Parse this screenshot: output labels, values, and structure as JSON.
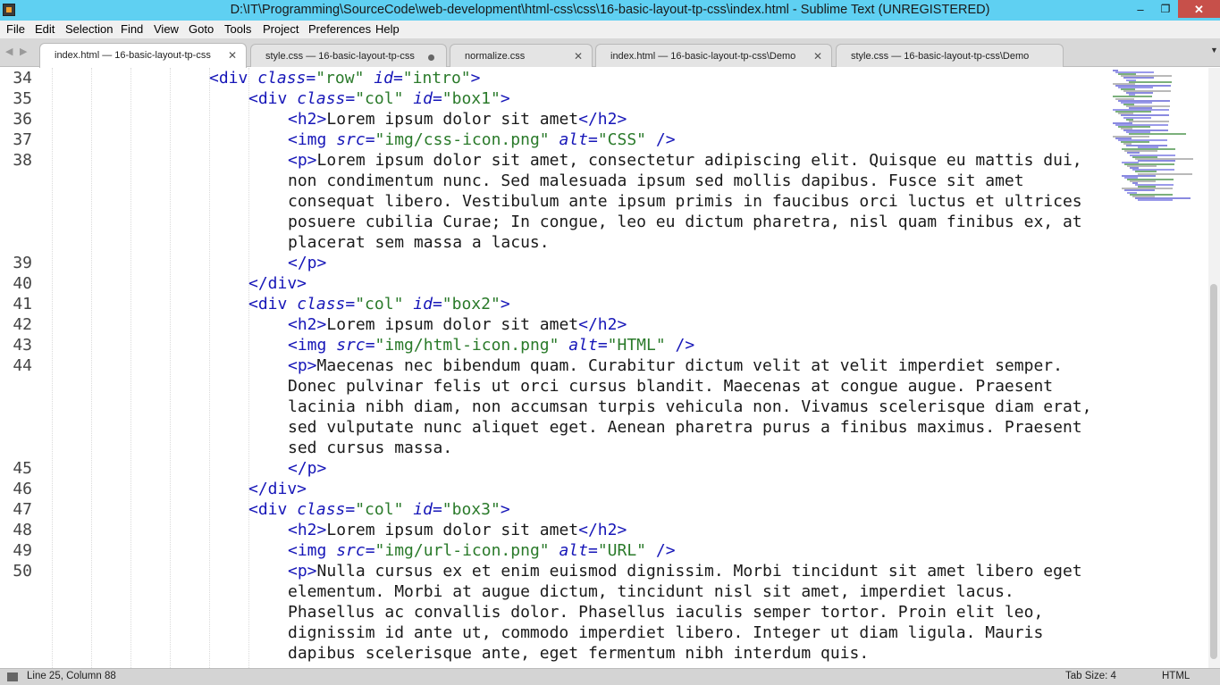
{
  "window": {
    "title": "D:\\IT\\Programming\\SourceCode\\web-development\\html-css\\css\\16-basic-layout-tp-css\\index.html - Sublime Text (UNREGISTERED)",
    "minimize": "–",
    "maximize": "❐",
    "close": "✕"
  },
  "menu": [
    "File",
    "Edit",
    "Selection",
    "Find",
    "View",
    "Goto",
    "Tools",
    "Project",
    "Preferences",
    "Help"
  ],
  "tab_nav": {
    "left": "◀",
    "right": "▶"
  },
  "tabs": [
    {
      "label": "index.html — 16-basic-layout-tp-css",
      "active": true,
      "modified": false
    },
    {
      "label": "style.css — 16-basic-layout-tp-css",
      "active": false,
      "modified": true
    },
    {
      "label": "normalize.css",
      "active": false,
      "modified": false
    },
    {
      "label": "index.html — 16-basic-layout-tp-css\\Demo",
      "active": false,
      "modified": false
    },
    {
      "label": "style.css — 16-basic-layout-tp-css\\Demo",
      "active": false,
      "modified": false
    }
  ],
  "tab_close": "✕",
  "tab_list_arrow": "▼",
  "editor": {
    "rows": [
      {
        "num": "34",
        "indent": 4,
        "tokens": [
          [
            "tg",
            "<div "
          ],
          [
            "at",
            "class"
          ],
          [
            "tg",
            "="
          ],
          [
            "st",
            "\"row\""
          ],
          [
            "tg",
            " "
          ],
          [
            "at",
            "id"
          ],
          [
            "tg",
            "="
          ],
          [
            "st",
            "\"intro\""
          ],
          [
            "tg",
            ">"
          ]
        ]
      },
      {
        "num": "35",
        "indent": 5,
        "tokens": [
          [
            "tg",
            "<div "
          ],
          [
            "at",
            "class"
          ],
          [
            "tg",
            "="
          ],
          [
            "st",
            "\"col\""
          ],
          [
            "tg",
            " "
          ],
          [
            "at",
            "id"
          ],
          [
            "tg",
            "="
          ],
          [
            "st",
            "\"box1\""
          ],
          [
            "tg",
            ">"
          ]
        ]
      },
      {
        "num": "36",
        "indent": 6,
        "tokens": [
          [
            "tg",
            "<h2>"
          ],
          [
            "tx",
            "Lorem ipsum dolor sit amet"
          ],
          [
            "tg",
            "</h2>"
          ]
        ]
      },
      {
        "num": "37",
        "indent": 6,
        "tokens": [
          [
            "tg",
            "<img "
          ],
          [
            "at",
            "src"
          ],
          [
            "tg",
            "="
          ],
          [
            "st",
            "\"img/css-icon.png\""
          ],
          [
            "tg",
            " "
          ],
          [
            "at",
            "alt"
          ],
          [
            "tg",
            "="
          ],
          [
            "st",
            "\"CSS\""
          ],
          [
            "tg",
            " />"
          ]
        ]
      },
      {
        "num": "38",
        "indent": 6,
        "tokens": [
          [
            "tg",
            "<p>"
          ],
          [
            "tx",
            "Lorem ipsum dolor sit amet, consectetur adipiscing elit. Quisque eu mattis dui,"
          ]
        ]
      },
      {
        "num": "",
        "indent": 6,
        "tokens": [
          [
            "tx",
            "non condimentum nunc. Sed malesuada ipsum sed mollis dapibus. Fusce sit amet"
          ]
        ]
      },
      {
        "num": "",
        "indent": 6,
        "tokens": [
          [
            "tx",
            "consequat libero. Vestibulum ante ipsum primis in faucibus orci luctus et ultrices"
          ]
        ]
      },
      {
        "num": "",
        "indent": 6,
        "tokens": [
          [
            "tx",
            "posuere cubilia Curae; In congue, leo eu dictum pharetra, nisl quam finibus ex, at"
          ]
        ]
      },
      {
        "num": "",
        "indent": 6,
        "tokens": [
          [
            "tx",
            "placerat sem massa a lacus."
          ]
        ]
      },
      {
        "num": "39",
        "indent": 6,
        "tokens": [
          [
            "tg",
            "</p>"
          ]
        ]
      },
      {
        "num": "40",
        "indent": 5,
        "tokens": [
          [
            "tg",
            "</div>"
          ]
        ]
      },
      {
        "num": "41",
        "indent": 5,
        "tokens": [
          [
            "tg",
            "<div "
          ],
          [
            "at",
            "class"
          ],
          [
            "tg",
            "="
          ],
          [
            "st",
            "\"col\""
          ],
          [
            "tg",
            " "
          ],
          [
            "at",
            "id"
          ],
          [
            "tg",
            "="
          ],
          [
            "st",
            "\"box2\""
          ],
          [
            "tg",
            ">"
          ]
        ]
      },
      {
        "num": "42",
        "indent": 6,
        "tokens": [
          [
            "tg",
            "<h2>"
          ],
          [
            "tx",
            "Lorem ipsum dolor sit amet"
          ],
          [
            "tg",
            "</h2>"
          ]
        ]
      },
      {
        "num": "43",
        "indent": 6,
        "tokens": [
          [
            "tg",
            "<img "
          ],
          [
            "at",
            "src"
          ],
          [
            "tg",
            "="
          ],
          [
            "st",
            "\"img/html-icon.png\""
          ],
          [
            "tg",
            " "
          ],
          [
            "at",
            "alt"
          ],
          [
            "tg",
            "="
          ],
          [
            "st",
            "\"HTML\""
          ],
          [
            "tg",
            " />"
          ]
        ]
      },
      {
        "num": "44",
        "indent": 6,
        "tokens": [
          [
            "tg",
            "<p>"
          ],
          [
            "tx",
            "Maecenas nec bibendum quam. Curabitur dictum velit at velit imperdiet semper."
          ]
        ]
      },
      {
        "num": "",
        "indent": 6,
        "tokens": [
          [
            "tx",
            "Donec pulvinar felis ut orci cursus blandit. Maecenas at congue augue. Praesent"
          ]
        ]
      },
      {
        "num": "",
        "indent": 6,
        "tokens": [
          [
            "tx",
            "lacinia nibh diam, non accumsan turpis vehicula non. Vivamus scelerisque diam erat,"
          ]
        ]
      },
      {
        "num": "",
        "indent": 6,
        "tokens": [
          [
            "tx",
            "sed vulputate nunc aliquet eget. Aenean pharetra purus a finibus maximus. Praesent"
          ]
        ]
      },
      {
        "num": "",
        "indent": 6,
        "tokens": [
          [
            "tx",
            "sed cursus massa."
          ]
        ]
      },
      {
        "num": "45",
        "indent": 6,
        "tokens": [
          [
            "tg",
            "</p>"
          ]
        ]
      },
      {
        "num": "46",
        "indent": 5,
        "tokens": [
          [
            "tg",
            "</div>"
          ]
        ]
      },
      {
        "num": "47",
        "indent": 5,
        "tokens": [
          [
            "tg",
            "<div "
          ],
          [
            "at",
            "class"
          ],
          [
            "tg",
            "="
          ],
          [
            "st",
            "\"col\""
          ],
          [
            "tg",
            " "
          ],
          [
            "at",
            "id"
          ],
          [
            "tg",
            "="
          ],
          [
            "st",
            "\"box3\""
          ],
          [
            "tg",
            ">"
          ]
        ]
      },
      {
        "num": "48",
        "indent": 6,
        "tokens": [
          [
            "tg",
            "<h2>"
          ],
          [
            "tx",
            "Lorem ipsum dolor sit amet"
          ],
          [
            "tg",
            "</h2>"
          ]
        ]
      },
      {
        "num": "49",
        "indent": 6,
        "tokens": [
          [
            "tg",
            "<img "
          ],
          [
            "at",
            "src"
          ],
          [
            "tg",
            "="
          ],
          [
            "st",
            "\"img/url-icon.png\""
          ],
          [
            "tg",
            " "
          ],
          [
            "at",
            "alt"
          ],
          [
            "tg",
            "="
          ],
          [
            "st",
            "\"URL\""
          ],
          [
            "tg",
            " />"
          ]
        ]
      },
      {
        "num": "50",
        "indent": 6,
        "tokens": [
          [
            "tg",
            "<p>"
          ],
          [
            "tx",
            "Nulla cursus ex et enim euismod dignissim. Morbi tincidunt sit amet libero eget"
          ]
        ]
      },
      {
        "num": "",
        "indent": 6,
        "tokens": [
          [
            "tx",
            "elementum. Morbi at augue dictum, tincidunt nisl sit amet, imperdiet lacus."
          ]
        ]
      },
      {
        "num": "",
        "indent": 6,
        "tokens": [
          [
            "tx",
            "Phasellus ac convallis dolor. Phasellus iaculis semper tortor. Proin elit leo,"
          ]
        ]
      },
      {
        "num": "",
        "indent": 6,
        "tokens": [
          [
            "tx",
            "dignissim id ante ut, commodo imperdiet libero. Integer ut diam ligula. Mauris"
          ]
        ]
      },
      {
        "num": "",
        "indent": 6,
        "tokens": [
          [
            "tx",
            "dapibus scelerisque ante, eget fermentum nibh interdum quis."
          ]
        ]
      }
    ]
  },
  "status": {
    "position": "Line 25, Column 88",
    "tab_size": "Tab Size: 4",
    "syntax": "HTML"
  },
  "colors": {
    "titlebar": "#5fd0f2",
    "tag": "#1616b8",
    "string": "#2a7a2a",
    "close_button": "#c7504a"
  }
}
